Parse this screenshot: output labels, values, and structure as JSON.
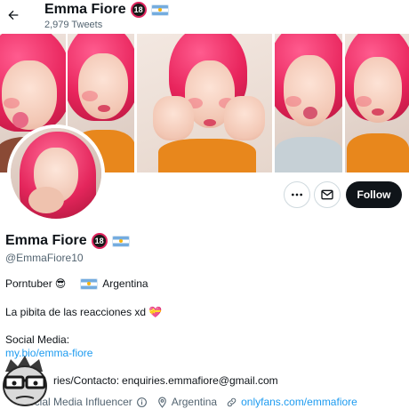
{
  "header": {
    "name": "Emma Fiore",
    "badge_text": "18",
    "tweet_count": "2,979 Tweets"
  },
  "profile": {
    "name": "Emma Fiore",
    "badge_text": "18",
    "handle": "@EmmaFiore10"
  },
  "bio": {
    "line1_text": "Porntuber",
    "line1_emoji": "😎",
    "line1_location": "Argentina",
    "line2_text": "La pibita de las reacciones xd",
    "line2_emoji": "💝",
    "line3": "Social Media:",
    "link": "my.bio/emma-fiore",
    "line5_prefix": "ries/Contacto:",
    "line5_email": "enquiries.emmafiore@gmail.com"
  },
  "meta": {
    "category": "Social Media Influencer",
    "location": "Argentina",
    "website": "onlyfans.com/emmafiore"
  },
  "actions": {
    "follow_label": "Follow"
  },
  "icons": {
    "back": "arrow-left-icon",
    "more": "more-dots-icon",
    "message": "envelope-icon",
    "info": "info-circle-icon",
    "location": "location-pin-icon",
    "link": "link-icon"
  },
  "colors": {
    "accent": "#1d9bf0",
    "follow_bg": "#0f1419",
    "muted_text": "#536471",
    "hair": "#e8245c"
  }
}
